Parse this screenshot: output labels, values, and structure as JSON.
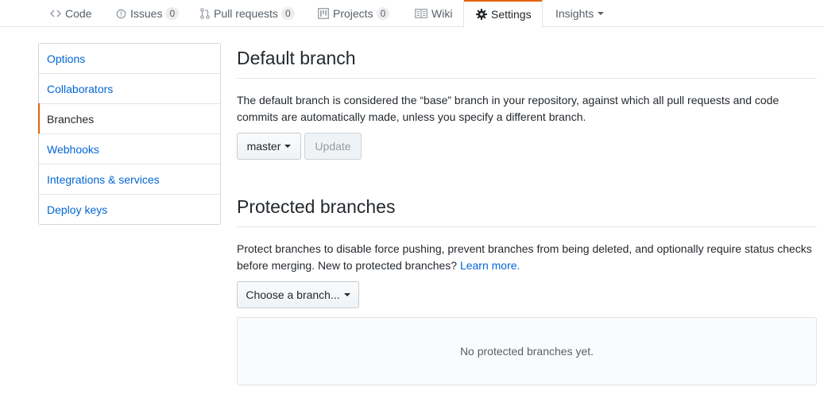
{
  "tabs": [
    {
      "label": "Code",
      "icon": "code-icon"
    },
    {
      "label": "Issues",
      "count": "0",
      "icon": "issue-icon"
    },
    {
      "label": "Pull requests",
      "count": "0",
      "icon": "pull-request-icon"
    },
    {
      "label": "Projects",
      "count": "0",
      "icon": "project-icon"
    },
    {
      "label": "Wiki",
      "icon": "book-icon"
    },
    {
      "label": "Settings",
      "icon": "gear-icon",
      "selected": true
    },
    {
      "label": "Insights",
      "icon": "caret-down-icon"
    }
  ],
  "sidebar": {
    "items": [
      {
        "label": "Options"
      },
      {
        "label": "Collaborators"
      },
      {
        "label": "Branches",
        "selected": true
      },
      {
        "label": "Webhooks"
      },
      {
        "label": "Integrations & services"
      },
      {
        "label": "Deploy keys"
      }
    ]
  },
  "default_branch": {
    "title": "Default branch",
    "description": "The default branch is considered the “base” branch in your repository, against which all pull requests and code commits are automatically made, unless you specify a different branch.",
    "branch_select_label": "master",
    "update_button_label": "Update"
  },
  "protected_branches": {
    "title": "Protected branches",
    "description": "Protect branches to disable force pushing, prevent branches from being deleted, and optionally require status checks before merging. New to protected branches?",
    "learn_more_label": "Learn more.",
    "choose_branch_label": "Choose a branch...",
    "empty_message": "No protected branches yet."
  },
  "colors": {
    "accent": "#e36209",
    "link": "#0366d6",
    "text": "#24292e",
    "muted": "#586069"
  }
}
